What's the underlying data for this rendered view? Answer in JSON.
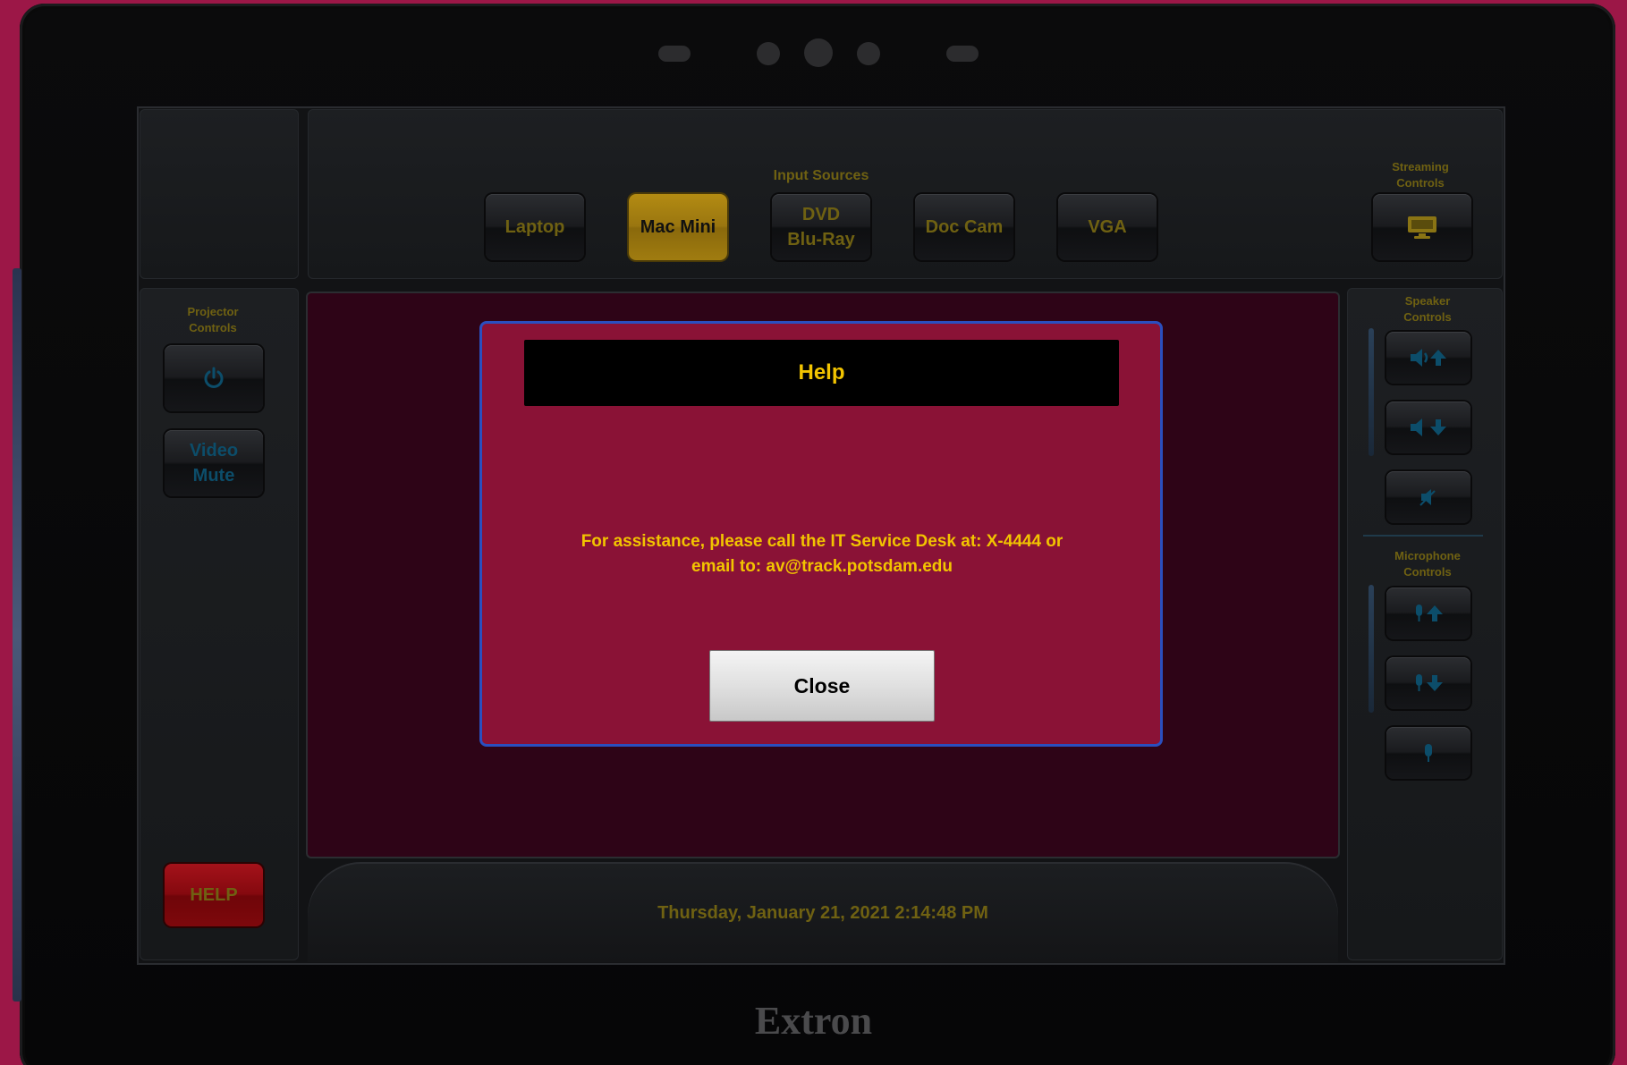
{
  "header": {
    "input_sources_label": "Input Sources",
    "streaming_label_line1": "Streaming",
    "streaming_label_line2": "Controls"
  },
  "sources": [
    {
      "label_line1": "Laptop",
      "label_line2": "",
      "active": false
    },
    {
      "label_line1": "Mac Mini",
      "label_line2": "",
      "active": true
    },
    {
      "label_line1": "DVD",
      "label_line2": "Blu-Ray",
      "active": false
    },
    {
      "label_line1": "Doc Cam",
      "label_line2": "",
      "active": false
    },
    {
      "label_line1": "VGA",
      "label_line2": "",
      "active": false
    }
  ],
  "left_panel": {
    "projector_label_line1": "Projector",
    "projector_label_line2": "Controls",
    "video_mute_line1": "Video",
    "video_mute_line2": "Mute",
    "help_label": "HELP"
  },
  "right_panel": {
    "speaker_label_line1": "Speaker",
    "speaker_label_line2": "Controls",
    "mic_label_line1": "Microphone",
    "mic_label_line2": "Controls"
  },
  "dialog": {
    "title": "Help",
    "message_line1": "For assistance, please call the IT Service Desk at: X-4444 or",
    "message_line2": "email to: av@track.potsdam.edu",
    "close_label": "Close"
  },
  "footer": {
    "datetime": "Thursday, January 21, 2021 2:14:48 PM"
  },
  "brand": "Extron",
  "colors": {
    "accent_text": "#6f6112",
    "active_source": "#9a7610",
    "dialog_bg": "#8a1236",
    "dialog_border": "#2a4fbf",
    "dialog_text": "#f2c400",
    "icon_blue": "#0c4d6a",
    "help_red": "#85090f"
  },
  "icons": {
    "streaming": "monitor-icon",
    "projector_power": "power-icon",
    "volume_up": "volume-up-icon",
    "volume_down": "volume-down-icon",
    "speaker_mute": "speaker-mute-icon",
    "mic_up": "mic-up-icon",
    "mic_down": "mic-down-icon",
    "mic_mute": "mic-mute-icon"
  }
}
